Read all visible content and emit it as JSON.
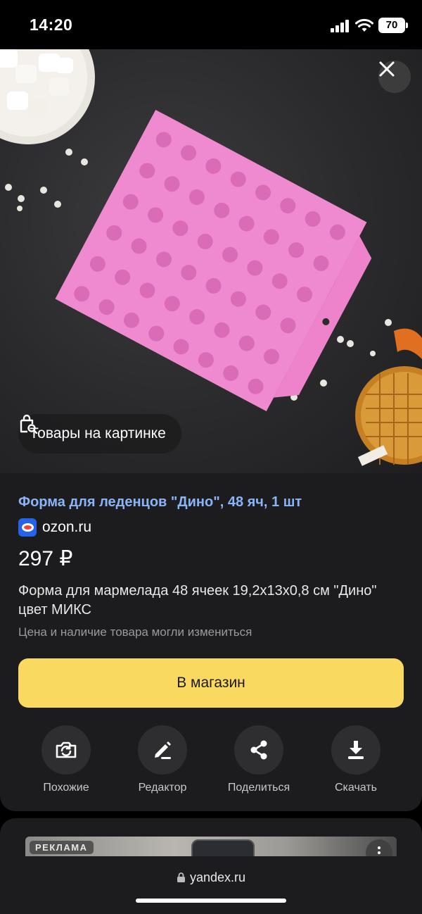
{
  "status_bar": {
    "time": "14:20",
    "battery": "70"
  },
  "hero": {
    "goods_chip_label": "Товары на картинке",
    "colors": {
      "mold": "#f08ad0",
      "background": "#2c2c2e"
    }
  },
  "product": {
    "title": "Форма для леденцов \"Дино\", 48 яч, 1 шт",
    "source": "ozon.ru",
    "price": "297 ₽",
    "description": "Форма для мармелада 48 ячеек 19,2х13х0,8 см \"Дино\" цвет МИКС",
    "disclaimer": "Цена и наличие товара могли измениться",
    "shop_button": "В магазин"
  },
  "actions": [
    {
      "label": "Похожие",
      "icon": "camera-search-icon"
    },
    {
      "label": "Редактор",
      "icon": "pencil-icon"
    },
    {
      "label": "Поделиться",
      "icon": "share-icon"
    },
    {
      "label": "Скачать",
      "icon": "download-icon"
    }
  ],
  "ad_card": {
    "badge": "РЕКЛАМА"
  },
  "browser": {
    "url": "yandex.ru"
  },
  "colors": {
    "accent_link": "#8ab4f8",
    "button_yellow": "#fad960",
    "card_bg": "#1c1c1e"
  }
}
